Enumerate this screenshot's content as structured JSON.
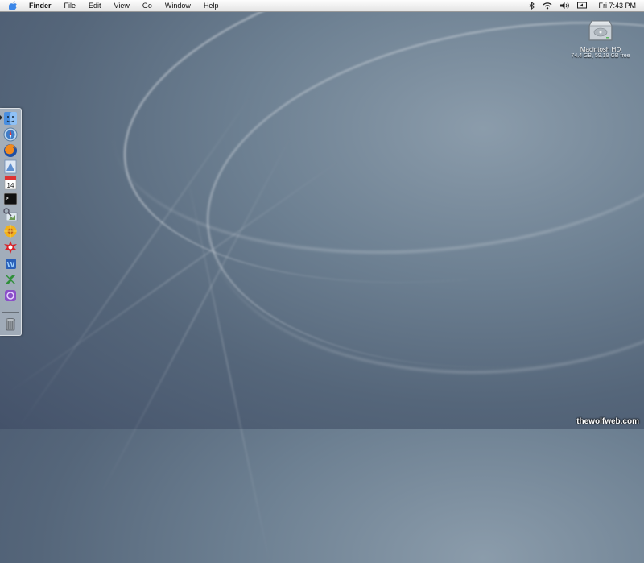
{
  "menubar": {
    "app_name": "Finder",
    "menus": [
      "File",
      "Edit",
      "View",
      "Go",
      "Window",
      "Help"
    ],
    "status_icons": [
      "bluetooth-icon",
      "wifi-icon",
      "volume-icon",
      "display-icon"
    ],
    "clock": "Fri 7:43 PM"
  },
  "desktop": {
    "drive": {
      "name": "Macintosh HD",
      "info": "74.4 GB, 59.18 GB free"
    }
  },
  "dock": {
    "items": [
      {
        "name": "finder-icon",
        "label": "Finder",
        "running": true
      },
      {
        "name": "safari-icon",
        "label": "Safari"
      },
      {
        "name": "firefox-icon",
        "label": "Firefox"
      },
      {
        "name": "mail-icon",
        "label": "Mail"
      },
      {
        "name": "ical-icon",
        "label": "iCal",
        "badge": "14"
      },
      {
        "name": "terminal-icon",
        "label": "Terminal"
      },
      {
        "name": "preview-icon",
        "label": "Preview"
      },
      {
        "name": "sunflower-app-icon",
        "label": "App"
      },
      {
        "name": "grapher-app-icon",
        "label": "App"
      },
      {
        "name": "word-icon",
        "label": "Microsoft Word"
      },
      {
        "name": "excel-icon",
        "label": "Microsoft Excel"
      },
      {
        "name": "entourage-icon",
        "label": "Microsoft Entourage"
      },
      {
        "name": "trash-icon",
        "label": "Trash"
      }
    ]
  },
  "watermark": "thewolfweb.com",
  "colors": {
    "menubar_top": "#fdfdfd",
    "menubar_bottom": "#e4e4e4",
    "desktop_dark": "#44526a",
    "desktop_light": "#8b9cab"
  }
}
